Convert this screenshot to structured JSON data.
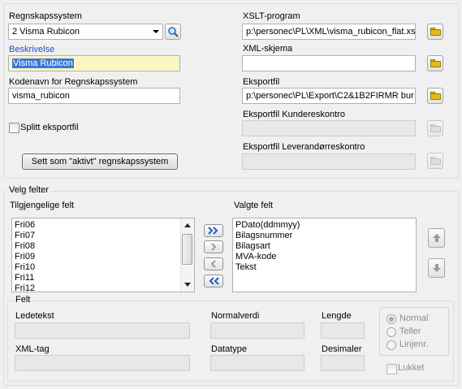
{
  "system": {
    "regnskapssystem_label": "Regnskapssystem",
    "regnskapssystem_value": "2 Visma Rubicon",
    "beskrivelse_label": "Beskrivelse",
    "beskrivelse_value": "Visma Rubicon",
    "kodenavn_label": "Kodenavn for Regnskapssystem",
    "kodenavn_value": "visma_rubicon",
    "splitt_label": "Splitt eksportfil",
    "activate_button": "Sett som \"aktivt\" regnskapssystem",
    "xslt_label": "XSLT-program",
    "xslt_value": "p:\\personec\\PL\\XML\\visma_rubicon_flat.xsl",
    "xml_schema_label": "XML-skjema",
    "xml_schema_value": "",
    "eksportfil_label": "Eksportfil",
    "eksportfil_value": "p:\\personec\\PL\\Export\\C2&1B2FIRMR bur",
    "kundereskontro_label": "Eksportfil Kundereskontro",
    "kundereskontro_value": "",
    "leverandor_label": "Eksportfil Leverandørreskontro",
    "leverandor_value": ""
  },
  "velg": {
    "legend": "Velg felter",
    "available_label": "Tilgjengelige felt",
    "available_items": [
      "Fri06",
      "Fri07",
      "Fri08",
      "Fri09",
      "Fri10",
      "Fri11",
      "Fri12"
    ],
    "selected_label": "Valgte felt",
    "selected_items": [
      "PDato(ddmmyy)",
      "Bilagsnummer",
      "Bilagsart",
      "MVA-kode",
      "Tekst"
    ]
  },
  "felt": {
    "legend": "Felt",
    "ledetekst_label": "Ledetekst",
    "normalverdi_label": "Normalverdi",
    "lengde_label": "Lengde",
    "xml_tag_label": "XML-tag",
    "datatype_label": "Datatype",
    "desimaler_label": "Desimaler",
    "radio_normal": "Normal",
    "radio_teller": "Teller",
    "radio_linjenr": "Linjenr.",
    "lukket_label": "Lukket"
  },
  "colors": {
    "accent_blue": "#1f4fbf",
    "selection": "#3b78d8",
    "highlight_field": "#fdf6c3"
  }
}
